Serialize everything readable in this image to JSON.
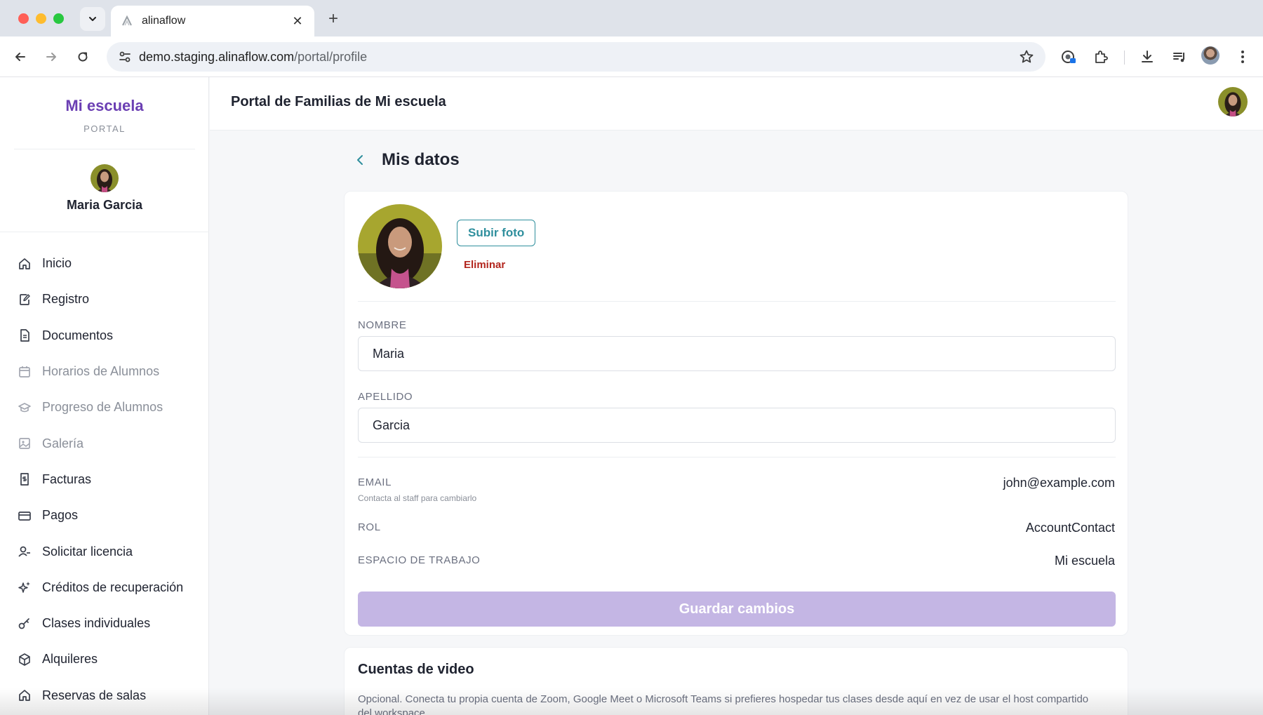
{
  "browser": {
    "tab_title": "alinaflow",
    "url_host": "demo.staging.alinaflow.com",
    "url_path": "/portal/profile",
    "icons": [
      "tab-list-icon",
      "close-icon",
      "new-tab-icon",
      "back-icon",
      "forward-icon",
      "reload-icon",
      "site-settings-icon",
      "star-icon",
      "password-manager-icon",
      "extensions-icon",
      "download-icon",
      "media-control-icon",
      "profile-avatar",
      "more-icon"
    ]
  },
  "sidebar": {
    "brand": "Mi escuela",
    "brand_sub": "PORTAL",
    "user_name": "Maria Garcia",
    "items": [
      {
        "label": "Inicio",
        "icon": "home-icon",
        "enabled": true
      },
      {
        "label": "Registro",
        "icon": "edit-document-icon",
        "enabled": true
      },
      {
        "label": "Documentos",
        "icon": "document-icon",
        "enabled": true
      },
      {
        "label": "Horarios de Alumnos",
        "icon": "calendar-icon",
        "enabled": false
      },
      {
        "label": "Progreso de Alumnos",
        "icon": "graduation-cap-icon",
        "enabled": false
      },
      {
        "label": "Galería",
        "icon": "image-icon",
        "enabled": false
      },
      {
        "label": "Facturas",
        "icon": "invoice-icon",
        "enabled": true
      },
      {
        "label": "Pagos",
        "icon": "credit-card-icon",
        "enabled": true
      },
      {
        "label": "Solicitar licencia",
        "icon": "user-minus-icon",
        "enabled": true
      },
      {
        "label": "Créditos de recuperación",
        "icon": "sparkles-icon",
        "enabled": true
      },
      {
        "label": "Clases individuales",
        "icon": "key-icon",
        "enabled": true
      },
      {
        "label": "Alquileres",
        "icon": "box-icon",
        "enabled": true
      },
      {
        "label": "Reservas de salas",
        "icon": "home-icon",
        "enabled": true
      }
    ]
  },
  "header": {
    "title": "Portal de Familias de Mi escuela"
  },
  "profile": {
    "page_title": "Mis datos",
    "upload_label": "Subir foto",
    "delete_label": "Eliminar",
    "first_name_label": "NOMBRE",
    "first_name_value": "Maria",
    "last_name_label": "APELLIDO",
    "last_name_value": "Garcia",
    "email_label": "EMAIL",
    "email_hint": "Contacta al staff para cambiarlo",
    "email_value": "john@example.com",
    "role_label": "ROL",
    "role_value": "AccountContact",
    "workspace_label": "ESPACIO DE TRABAJO",
    "workspace_value": "Mi escuela",
    "save_label": "Guardar cambios",
    "save_enabled": false
  },
  "video_accounts": {
    "title": "Cuentas de video",
    "description": "Opcional. Conecta tu propia cuenta de Zoom, Google Meet o Microsoft Teams si prefieres hospedar tus clases desde aquí en vez de usar el host compartido del workspace."
  },
  "colors": {
    "brand": "#6b3fb3",
    "accent_teal": "#2f8f9d",
    "danger": "#b3261e",
    "save_disabled": "#c4b6e4"
  }
}
